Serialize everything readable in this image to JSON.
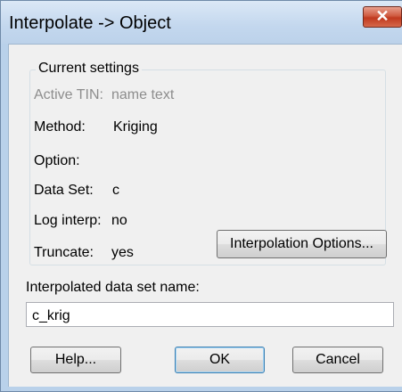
{
  "window": {
    "title": "Interpolate -> Object",
    "close_label": "✕"
  },
  "current_settings": {
    "legend": "Current settings",
    "active_tin_label": "Active TIN:",
    "active_tin_value": "name text",
    "method_label": "Method:",
    "method_value": "Kriging",
    "option_label": "Option:",
    "data_set_label": "Data Set:",
    "data_set_value": "c",
    "log_interp_label": "Log interp:",
    "log_interp_value": "no",
    "truncate_label": "Truncate:",
    "truncate_value": "yes",
    "interp_options_button": "Interpolation Options..."
  },
  "dataset_name": {
    "label": "Interpolated data set name:",
    "value": "c_krig"
  },
  "buttons": {
    "help": "Help...",
    "ok": "OK",
    "cancel": "Cancel"
  }
}
